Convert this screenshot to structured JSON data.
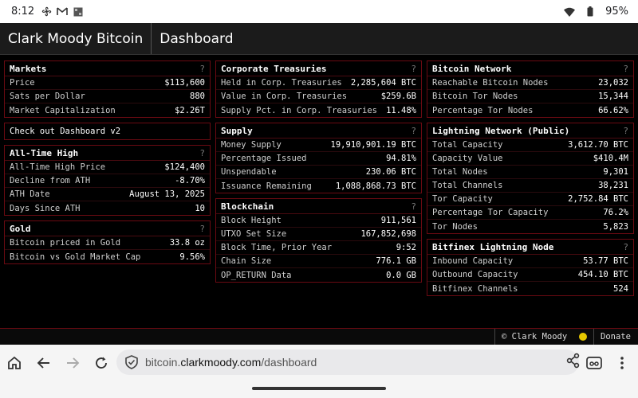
{
  "status": {
    "time": "8:12",
    "battery": "95%"
  },
  "header": {
    "brand": "Clark Moody Bitcoin",
    "page": "Dashboard"
  },
  "panels": {
    "markets": {
      "title": "Markets",
      "rows": [
        {
          "k": "Price",
          "v": "$113,600"
        },
        {
          "k": "Sats per Dollar",
          "v": "880"
        },
        {
          "k": "Market Capitalization",
          "v": "$2.26T"
        }
      ]
    },
    "checkout": {
      "text": "Check out Dashboard v2"
    },
    "ath": {
      "title": "All-Time High",
      "rows": [
        {
          "k": "All-Time High Price",
          "v": "$124,400"
        },
        {
          "k": "Decline from ATH",
          "v": "-8.70%"
        },
        {
          "k": "ATH Date",
          "v": "August 13, 2025"
        },
        {
          "k": "Days Since ATH",
          "v": "10"
        }
      ]
    },
    "gold": {
      "title": "Gold",
      "rows": [
        {
          "k": "Bitcoin priced in Gold",
          "v": "33.8 oz"
        },
        {
          "k": "Bitcoin vs Gold Market Cap",
          "v": "9.56%"
        }
      ]
    },
    "treasuries": {
      "title": "Corporate Treasuries",
      "rows": [
        {
          "k": "Held in Corp. Treasuries",
          "v": "2,285,604 BTC"
        },
        {
          "k": "Value in Corp. Treasuries",
          "v": "$259.6B"
        },
        {
          "k": "Supply Pct. in Corp. Treasuries",
          "v": "11.48%"
        }
      ]
    },
    "supply": {
      "title": "Supply",
      "rows": [
        {
          "k": "Money Supply",
          "v": "19,910,901.19 BTC"
        },
        {
          "k": "Percentage Issued",
          "v": "94.81%"
        },
        {
          "k": "Unspendable",
          "v": "230.06 BTC"
        },
        {
          "k": "Issuance Remaining",
          "v": "1,088,868.73 BTC"
        }
      ]
    },
    "blockchain": {
      "title": "Blockchain",
      "rows": [
        {
          "k": "Block Height",
          "v": "911,561"
        },
        {
          "k": "UTXO Set Size",
          "v": "167,852,698"
        },
        {
          "k": "Block Time, Prior Year",
          "v": "9:52"
        },
        {
          "k": "Chain Size",
          "v": "776.1 GB"
        },
        {
          "k": "OP_RETURN Data",
          "v": "0.0 GB"
        }
      ]
    },
    "network": {
      "title": "Bitcoin Network",
      "rows": [
        {
          "k": "Reachable Bitcoin Nodes",
          "v": "23,032"
        },
        {
          "k": "Bitcoin Tor Nodes",
          "v": "15,344"
        },
        {
          "k": "Percentage Tor Nodes",
          "v": "66.62%"
        }
      ]
    },
    "lightning": {
      "title": "Lightning Network (Public)",
      "rows": [
        {
          "k": "Total Capacity",
          "v": "3,612.70 BTC"
        },
        {
          "k": "Capacity Value",
          "v": "$410.4M"
        },
        {
          "k": "Total Nodes",
          "v": "9,301"
        },
        {
          "k": "Total Channels",
          "v": "38,231"
        },
        {
          "k": "Tor Capacity",
          "v": "2,752.84 BTC"
        },
        {
          "k": "Percentage Tor Capacity",
          "v": "76.2%"
        },
        {
          "k": "Tor Nodes",
          "v": "5,823"
        }
      ]
    },
    "bitfinex": {
      "title": "Bitfinex Lightning Node",
      "rows": [
        {
          "k": "Inbound Capacity",
          "v": "53.77 BTC"
        },
        {
          "k": "Outbound Capacity",
          "v": "454.10 BTC"
        },
        {
          "k": "Bitfinex Channels",
          "v": "524"
        }
      ]
    }
  },
  "help_glyph": "?",
  "footer": {
    "copyright": "© Clark Moody",
    "donate": "Donate"
  },
  "browser": {
    "url_host_prefix": "bitcoin.",
    "url_host": "clarkmoody.com",
    "url_path": "/dashboard"
  },
  "colors": {
    "panel_border": "#6b0a12",
    "status_dot": "#e6c700"
  }
}
